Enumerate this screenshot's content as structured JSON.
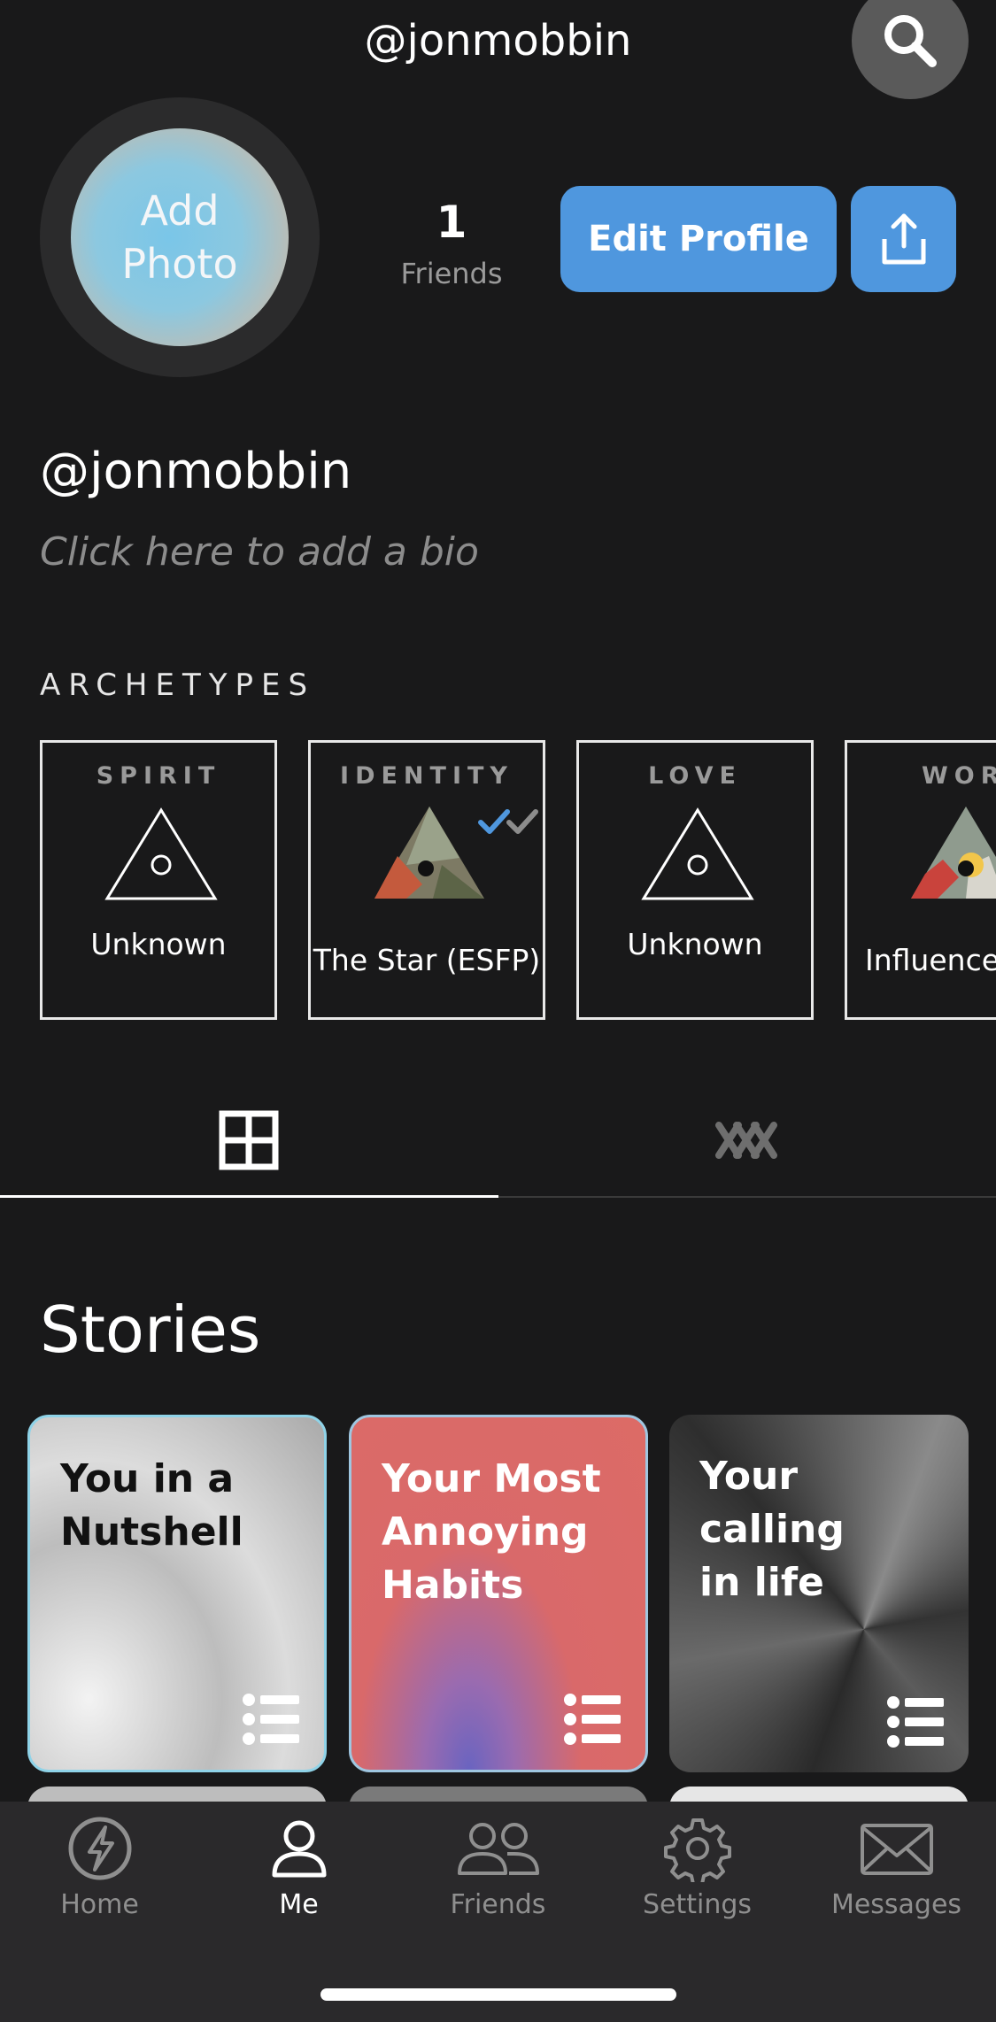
{
  "header": {
    "title": "@jonmobbin"
  },
  "profile": {
    "avatar_line1": "Add",
    "avatar_line2": "Photo",
    "friends_count": "1",
    "friends_label": "Friends",
    "edit_label": "Edit Profile",
    "handle": "@jonmobbin",
    "bio_placeholder": "Click here to add a bio"
  },
  "archetypes": {
    "section_label": "ARCHETYPES",
    "items": [
      {
        "category": "SPIRIT",
        "name": "Unknown"
      },
      {
        "category": "IDENTITY",
        "name": "The Star (ESFP)"
      },
      {
        "category": "LOVE",
        "name": "Unknown"
      },
      {
        "category": "WOR",
        "name": "Influence"
      }
    ]
  },
  "tabs": [
    {
      "name": "grid",
      "icon": "grid-icon",
      "active": true
    },
    {
      "name": "compatibility",
      "icon": "linked-rings-icon",
      "active": false
    }
  ],
  "stories": {
    "title": "Stories",
    "items": [
      {
        "title": "You in a Nutshell",
        "line1": "You in a",
        "line2": "Nutshell",
        "theme": "silver"
      },
      {
        "title": "Your Most Annoying Habits",
        "line1": "Your Most",
        "line2": "Annoying",
        "line3": "Habits",
        "theme": "coral"
      },
      {
        "title": "Your calling in life",
        "line1": "Your calling",
        "line2": "in life",
        "theme": "dark-metal"
      }
    ]
  },
  "nav": {
    "items": [
      {
        "label": "Home",
        "icon": "lightning-icon",
        "active": false
      },
      {
        "label": "Me",
        "icon": "person-icon",
        "active": true
      },
      {
        "label": "Friends",
        "icon": "friends-icon",
        "active": false
      },
      {
        "label": "Settings",
        "icon": "gear-icon",
        "active": false
      },
      {
        "label": "Messages",
        "icon": "envelope-icon",
        "active": false
      }
    ]
  },
  "colors": {
    "accent": "#4f97de",
    "background": "#19191a",
    "nav_bg": "#2a292b",
    "coral": "#dc6b66"
  }
}
